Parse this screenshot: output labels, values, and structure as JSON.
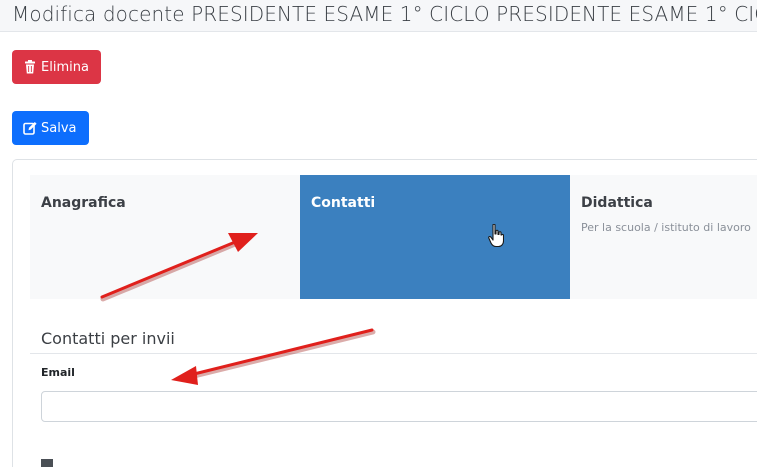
{
  "page": {
    "title": "Modifica docente PRESIDENTE ESAME 1° CICLO PRESIDENTE ESAME 1° CICLO"
  },
  "actions": {
    "delete_label": "Elimina",
    "delete_icon": "trash-icon",
    "save_label": "Salva",
    "save_icon": "edit-icon",
    "delete_color": "#dc3545",
    "save_color": "#0d6efd"
  },
  "tabs": [
    {
      "label": "Anagrafica",
      "subtitle": ""
    },
    {
      "label": "Contatti",
      "subtitle": "",
      "active": true
    },
    {
      "label": "Didattica",
      "subtitle": "Per la scuola / istituto di lavoro"
    }
  ],
  "active_tab_color": "#3b80bf",
  "contacts": {
    "section_title": "Contatti per invii",
    "email_label": "Email",
    "email_value": ""
  },
  "annotations": {
    "arrow_color": "#e0201c"
  }
}
